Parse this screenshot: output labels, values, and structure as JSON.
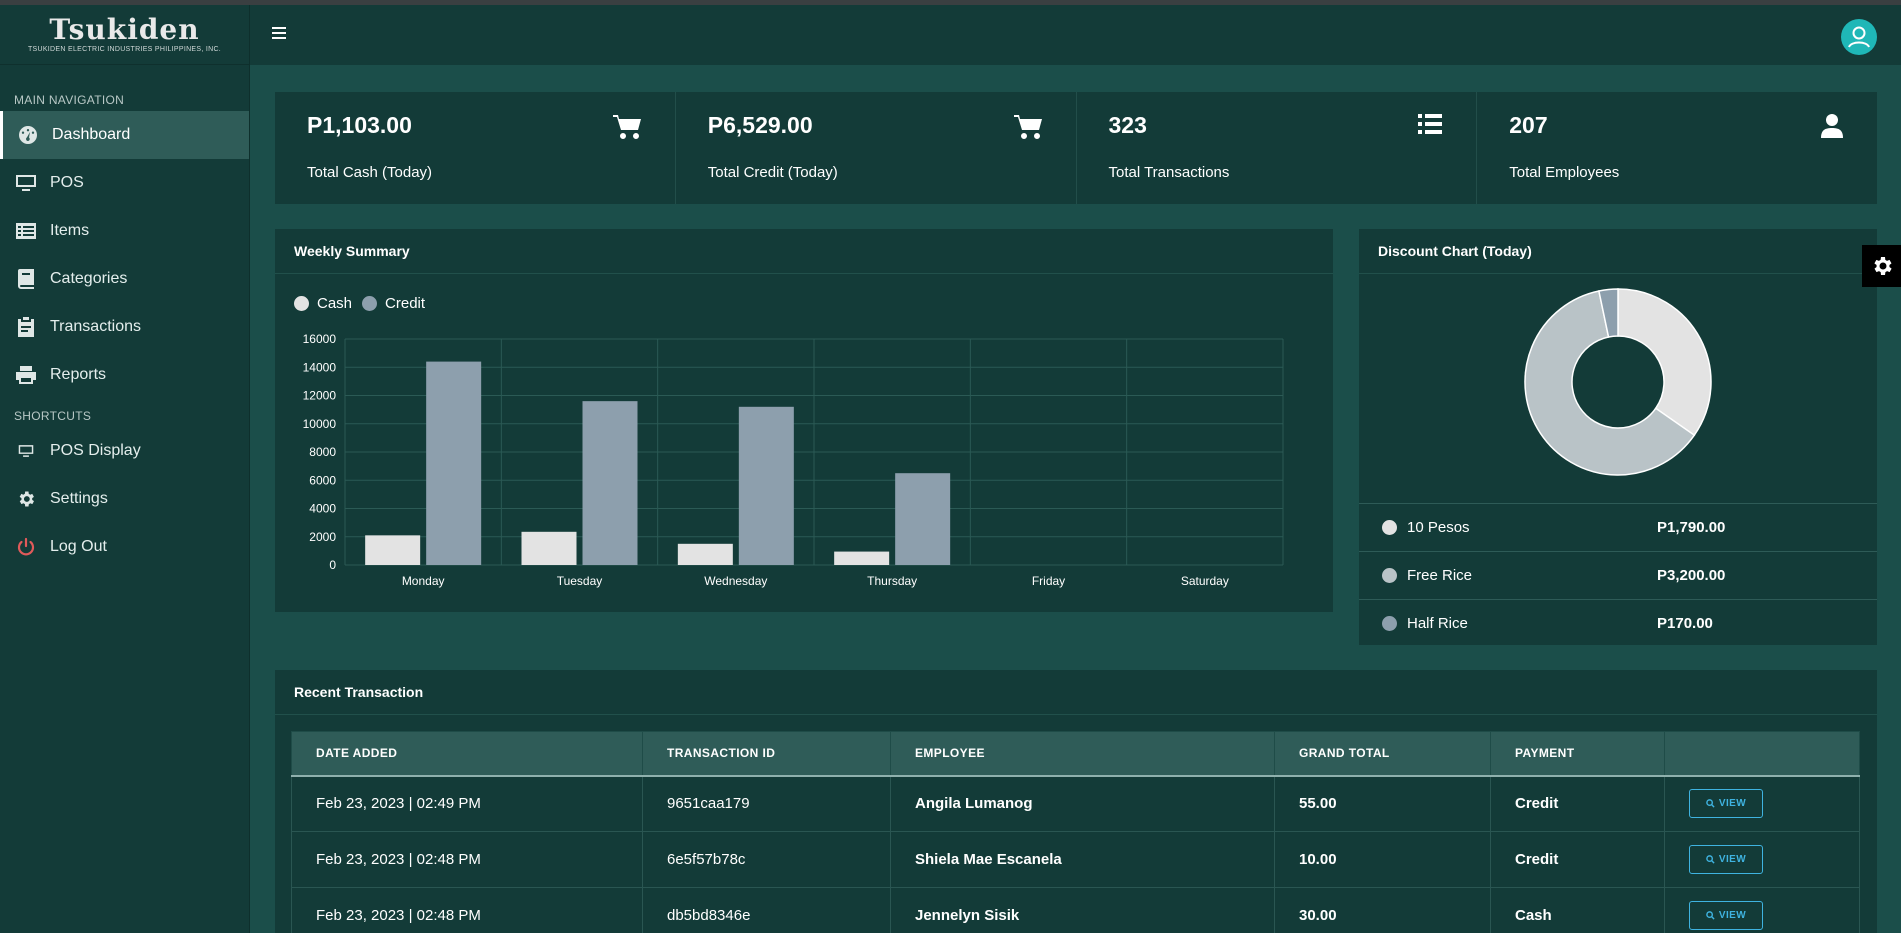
{
  "brand": {
    "name": "Tsukiden",
    "subtitle": "TSUKIDEN ELECTRIC INDUSTRIES PHILIPPINES, INC."
  },
  "sidebar": {
    "main_header": "MAIN NAVIGATION",
    "shortcuts_header": "SHORTCUTS",
    "items": [
      {
        "label": "Dashboard",
        "icon": "dashboard-icon"
      },
      {
        "label": "POS",
        "icon": "monitor-icon"
      },
      {
        "label": "Items",
        "icon": "list-icon"
      },
      {
        "label": "Categories",
        "icon": "book-icon"
      },
      {
        "label": "Transactions",
        "icon": "clipboard-icon"
      },
      {
        "label": "Reports",
        "icon": "printer-icon"
      }
    ],
    "shortcuts": [
      {
        "label": "POS Display",
        "icon": "monitor-icon"
      },
      {
        "label": "Settings",
        "icon": "gear-icon"
      },
      {
        "label": "Log Out",
        "icon": "power-icon"
      }
    ]
  },
  "stats": [
    {
      "value": "P1,103.00",
      "label": "Total Cash (Today)",
      "icon": "cart-icon"
    },
    {
      "value": "P6,529.00",
      "label": "Total Credit (Today)",
      "icon": "cart-icon"
    },
    {
      "value": "323",
      "label": "Total Transactions",
      "icon": "list-icon"
    },
    {
      "value": "207",
      "label": "Total Employees",
      "icon": "user-icon"
    }
  ],
  "weekly": {
    "title": "Weekly Summary"
  },
  "chart_data": {
    "type": "bar",
    "categories": [
      "Monday",
      "Tuesday",
      "Wednesday",
      "Thursday",
      "Friday",
      "Saturday"
    ],
    "series": [
      {
        "name": "Cash",
        "values": [
          2100,
          2350,
          1500,
          950,
          0,
          0
        ],
        "color": "#e3e3e3"
      },
      {
        "name": "Credit",
        "values": [
          14400,
          11600,
          11200,
          6500,
          0,
          0
        ],
        "color": "#8d9fad"
      }
    ],
    "yticks": [
      "16000",
      "14000",
      "12000",
      "10000",
      "8000",
      "6000",
      "4000",
      "2000",
      "0"
    ],
    "ylim": [
      0,
      16000
    ],
    "legend": "top-left",
    "grid": true
  },
  "discount": {
    "title": "Discount Chart (Today)",
    "items": [
      {
        "name": "10 Pesos",
        "amount": "P1,790.00",
        "value": 1790,
        "color": "#e3e3e3"
      },
      {
        "name": "Free Rice",
        "amount": "P3,200.00",
        "value": 3200,
        "color": "#b9c3c7"
      },
      {
        "name": "Half Rice",
        "amount": "P170.00",
        "value": 170,
        "color": "#8d9fad"
      }
    ]
  },
  "recent": {
    "title": "Recent Transaction",
    "columns": [
      "DATE ADDED",
      "TRANSACTION ID",
      "EMPLOYEE",
      "GRAND TOTAL",
      "PAYMENT",
      ""
    ],
    "view_label": "VIEW",
    "rows": [
      {
        "date": "Feb 23, 2023 | 02:49 PM",
        "id": "9651caa179",
        "employee": "Angila Lumanog",
        "total": "55.00",
        "payment": "Credit"
      },
      {
        "date": "Feb 23, 2023 | 02:48 PM",
        "id": "6e5f57b78c",
        "employee": "Shiela Mae Escanela",
        "total": "10.00",
        "payment": "Credit"
      },
      {
        "date": "Feb 23, 2023 | 02:48 PM",
        "id": "db5bd8346e",
        "employee": "Jennelyn Sisik",
        "total": "30.00",
        "payment": "Cash"
      }
    ]
  }
}
